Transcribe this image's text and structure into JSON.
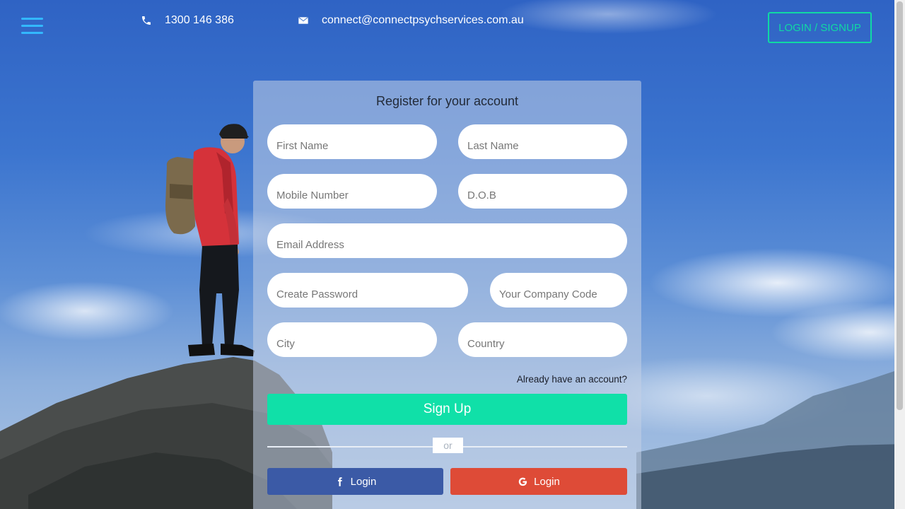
{
  "header": {
    "phone": "1300 146 386",
    "email": "connect@connectpsychservices.com.au",
    "login_signup_label": "LOGIN / SIGNUP",
    "icons": {
      "menu": "hamburger-menu-icon",
      "phone": "phone-icon",
      "email": "envelope-icon"
    }
  },
  "form": {
    "title": "Register for your account",
    "fields": {
      "first_name": "First Name",
      "last_name": "Last Name",
      "mobile": "Mobile Number",
      "dob": "D.O.B",
      "email": "Email Address",
      "password": "Create Password",
      "company_code": "Your Company Code",
      "city": "City",
      "country": "Country"
    },
    "already_have_account": "Already have an account?",
    "signup_label": "Sign Up",
    "or_label": "or",
    "facebook_login_label": "Login",
    "google_login_label": "Login"
  },
  "colors": {
    "accent": "#10e0a8",
    "menu_icon": "#33b8ff",
    "facebook": "#3b5aa6",
    "google": "#de4b37"
  }
}
